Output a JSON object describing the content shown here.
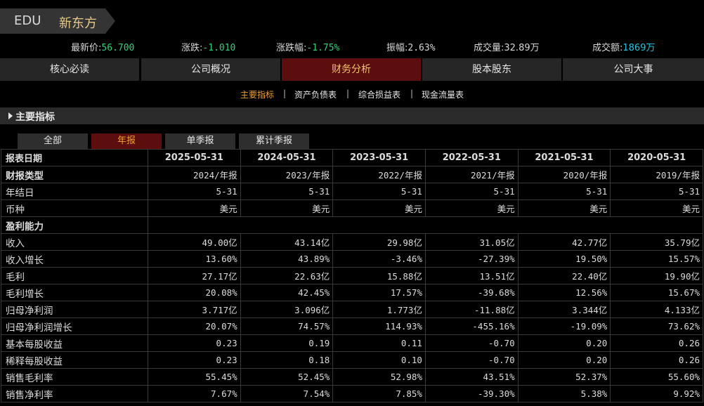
{
  "header": {
    "code": "EDU",
    "name": "新东方"
  },
  "quote": {
    "last_price_label": "最新价:",
    "last_price": "56.700",
    "change_label": "涨跌:",
    "change": "-1.010",
    "change_pct_label": "涨跌幅:",
    "change_pct": "-1.75%",
    "amplitude_label": "振幅:",
    "amplitude": "2.63%",
    "volume_label": "成交量:",
    "volume": "32.89万",
    "turnover_label": "成交额:",
    "turnover": "1869万",
    "colors": {
      "green": "#31d07a",
      "cyan": "#27c6e0"
    }
  },
  "nav": {
    "tabs": [
      "核心必读",
      "公司概况",
      "财务分析",
      "股本股东",
      "公司大事"
    ],
    "active": 2
  },
  "subnav": {
    "items": [
      "主要指标",
      "资产负债表",
      "综合损益表",
      "现金流量表"
    ],
    "separator": "|"
  },
  "section": {
    "title": "主要指标"
  },
  "period_tabs": {
    "tabs": [
      "全部",
      "年报",
      "单季报",
      "累计季报"
    ],
    "active": 1
  },
  "table": {
    "header": {
      "label": "报表日期",
      "values": [
        "2025-05-31",
        "2024-05-31",
        "2023-05-31",
        "2022-05-31",
        "2021-05-31",
        "2020-05-31"
      ]
    },
    "rows": [
      {
        "label": "财报类型",
        "values": [
          "2024/年报",
          "2023/年报",
          "2022/年报",
          "2021/年报",
          "2020/年报",
          "2019/年报"
        ]
      },
      {
        "label": "年结日",
        "values": [
          "5-31",
          "5-31",
          "5-31",
          "5-31",
          "5-31",
          "5-31"
        ]
      },
      {
        "label": "币种",
        "values": [
          "美元",
          "美元",
          "美元",
          "美元",
          "美元",
          "美元"
        ]
      },
      {
        "label": "盈利能力",
        "values": []
      },
      {
        "label": "收入",
        "values": [
          "49.00亿",
          "43.14亿",
          "29.98亿",
          "31.05亿",
          "42.77亿",
          "35.79亿"
        ]
      },
      {
        "label": "收入增长",
        "values": [
          "13.60%",
          "43.89%",
          "-3.46%",
          "-27.39%",
          "19.50%",
          "15.57%"
        ]
      },
      {
        "label": "毛利",
        "values": [
          "27.17亿",
          "22.63亿",
          "15.88亿",
          "13.51亿",
          "22.40亿",
          "19.90亿"
        ]
      },
      {
        "label": "毛利增长",
        "values": [
          "20.08%",
          "42.45%",
          "17.57%",
          "-39.68%",
          "12.56%",
          "15.67%"
        ]
      },
      {
        "label": "归母净利润",
        "values": [
          "3.717亿",
          "3.096亿",
          "1.773亿",
          "-11.88亿",
          "3.344亿",
          "4.133亿"
        ]
      },
      {
        "label": "归母净利润增长",
        "values": [
          "20.07%",
          "74.57%",
          "114.93%",
          "-455.16%",
          "-19.09%",
          "73.62%"
        ]
      },
      {
        "label": "基本每股收益",
        "values": [
          "0.23",
          "0.19",
          "0.11",
          "-0.70",
          "0.20",
          "0.26"
        ]
      },
      {
        "label": "稀释每股收益",
        "values": [
          "0.23",
          "0.18",
          "0.10",
          "-0.70",
          "0.20",
          "0.26"
        ]
      },
      {
        "label": "销售毛利率",
        "values": [
          "55.45%",
          "52.45%",
          "52.98%",
          "43.51%",
          "52.37%",
          "55.60%"
        ]
      },
      {
        "label": "销售净利率",
        "values": [
          "7.67%",
          "7.54%",
          "7.85%",
          "-39.30%",
          "5.38%",
          "9.92%"
        ]
      }
    ]
  }
}
